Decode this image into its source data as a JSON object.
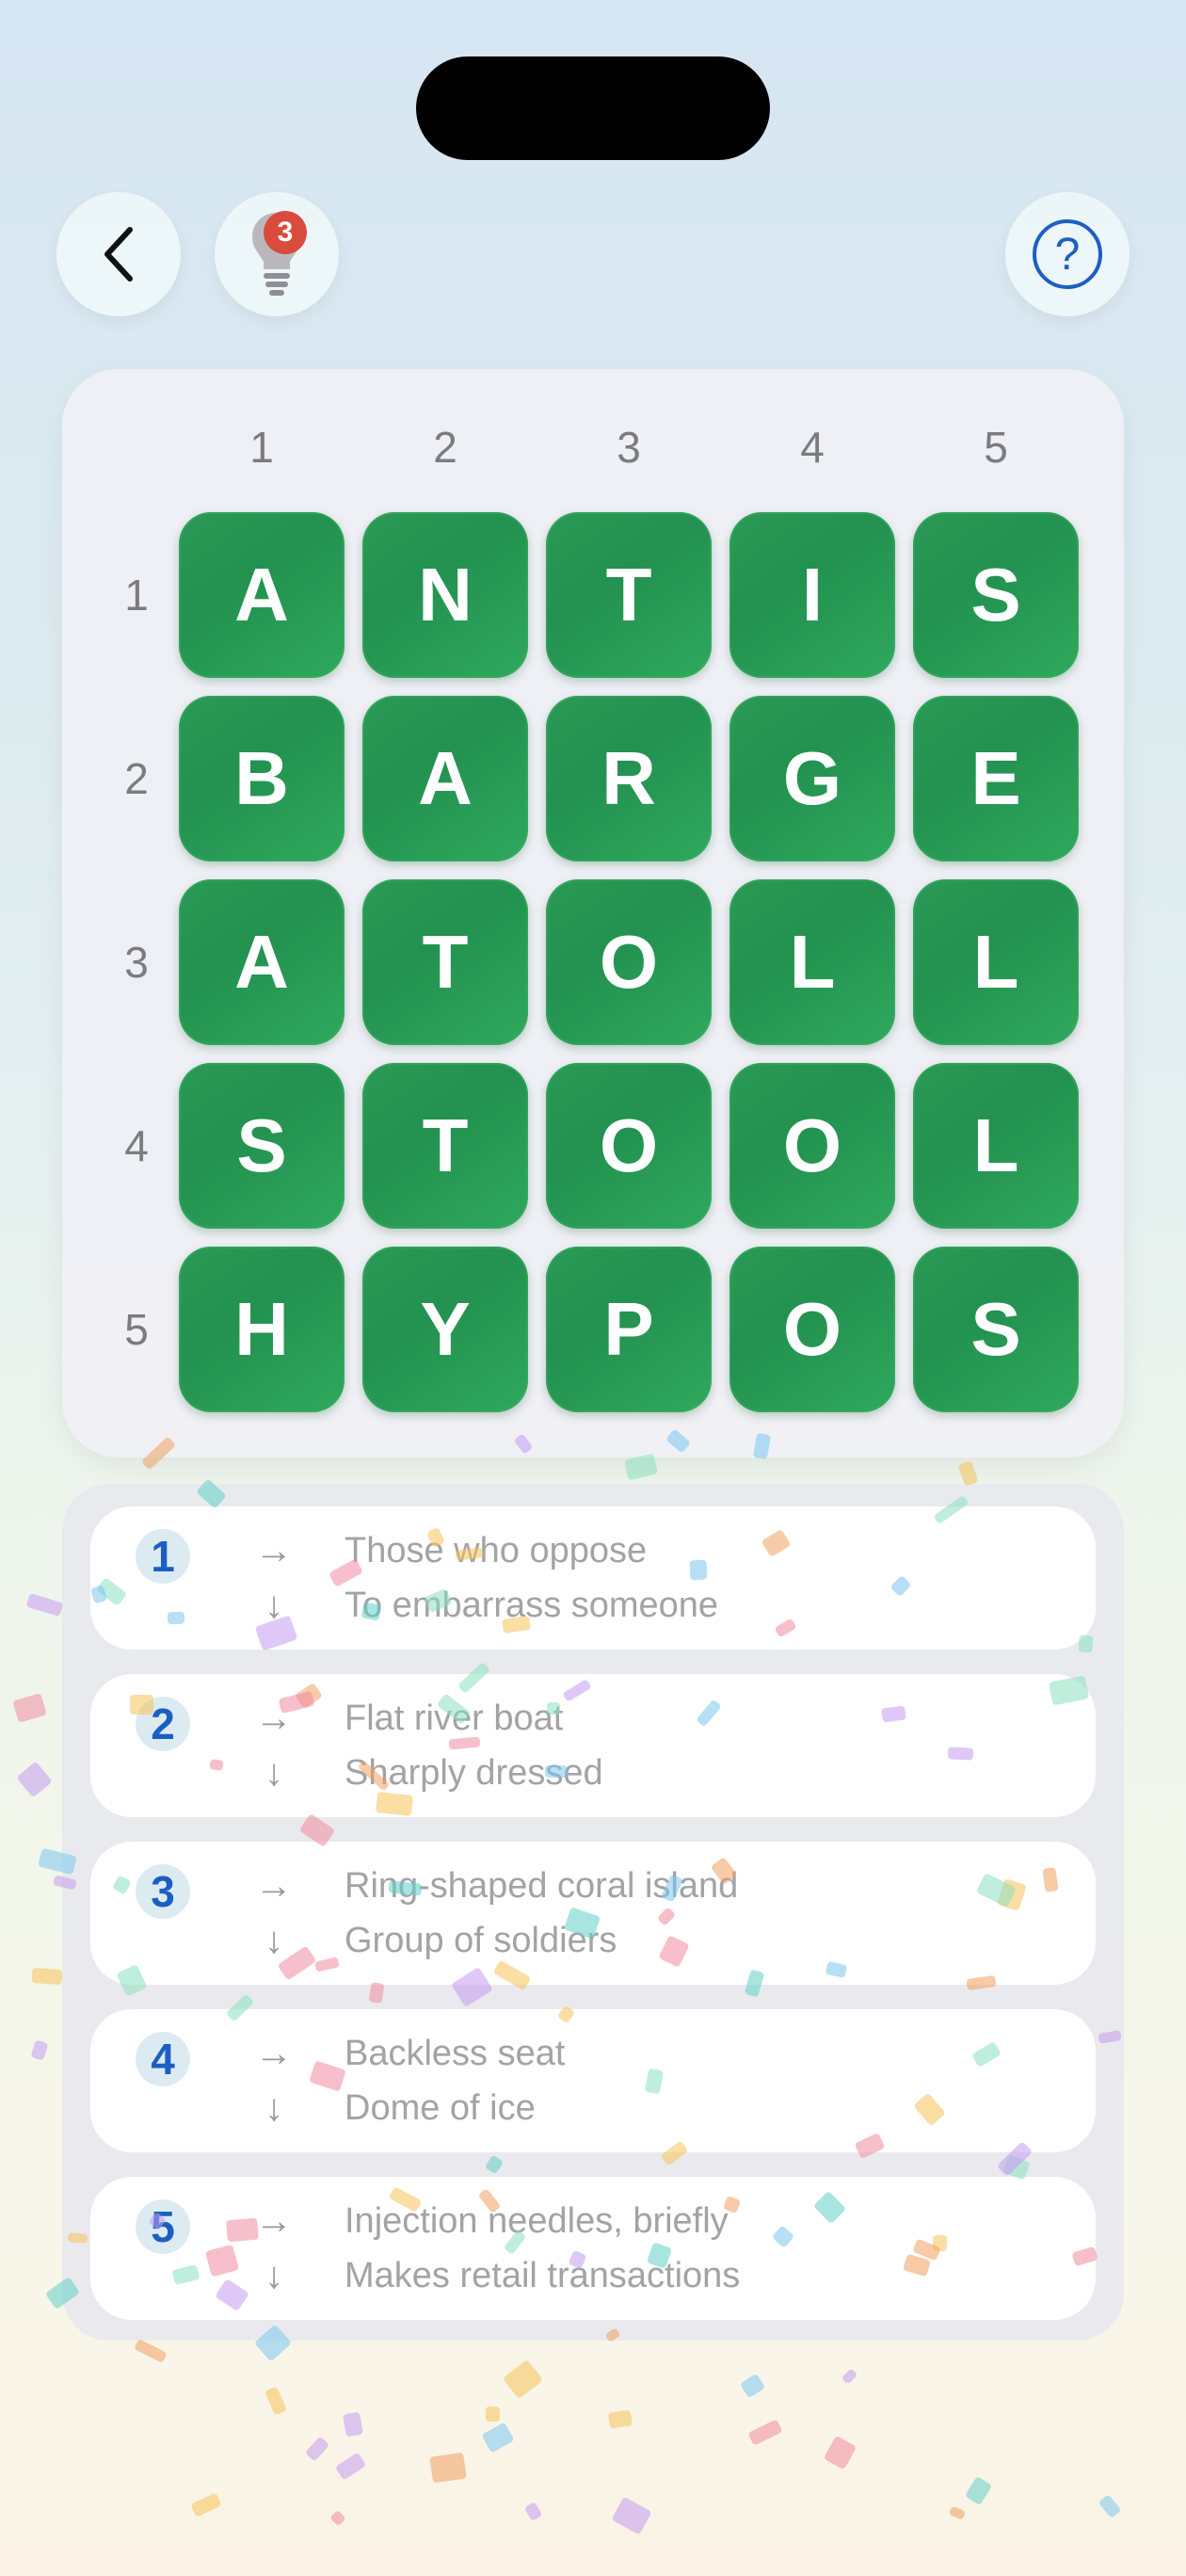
{
  "header": {
    "back_icon": "chevron-left-icon",
    "hint_icon": "lightbulb-icon",
    "hint_badge": "3",
    "help_label": "?"
  },
  "grid": {
    "col_numbers": [
      "1",
      "2",
      "3",
      "4",
      "5"
    ],
    "row_numbers": [
      "1",
      "2",
      "3",
      "4",
      "5"
    ],
    "rows": [
      [
        "A",
        "N",
        "T",
        "I",
        "S"
      ],
      [
        "B",
        "A",
        "R",
        "G",
        "E"
      ],
      [
        "A",
        "T",
        "O",
        "L",
        "L"
      ],
      [
        "S",
        "T",
        "O",
        "O",
        "L"
      ],
      [
        "H",
        "Y",
        "P",
        "O",
        "S"
      ]
    ],
    "tile_color": "#2a9a55"
  },
  "clues": [
    {
      "number": "1",
      "across_arrow": "→",
      "across": "Those who oppose",
      "down_arrow": "↓",
      "down": "To embarrass someone"
    },
    {
      "number": "2",
      "across_arrow": "→",
      "across": "Flat river boat",
      "down_arrow": "↓",
      "down": "Sharply dressed"
    },
    {
      "number": "3",
      "across_arrow": "→",
      "across": "Ring-shaped coral island",
      "down_arrow": "↓",
      "down": "Group of soldiers"
    },
    {
      "number": "4",
      "across_arrow": "→",
      "across": "Backless seat",
      "down_arrow": "↓",
      "down": "Dome of ice"
    },
    {
      "number": "5",
      "across_arrow": "→",
      "across": "Injection needles, briefly",
      "down_arrow": "↓",
      "down": "Makes retail transactions"
    }
  ],
  "colors": {
    "accent_blue": "#1c5fc4",
    "badge_red": "#d94b3c"
  }
}
